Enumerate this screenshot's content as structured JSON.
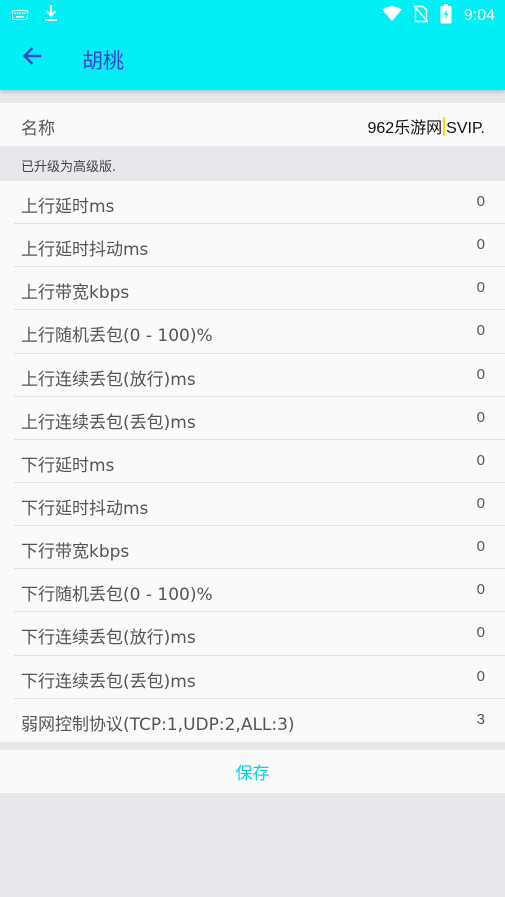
{
  "status_bar": {
    "time": "9:04",
    "icons": [
      "keyboard-icon",
      "download-icon",
      "wifi-icon",
      "no-sim-icon",
      "battery-icon"
    ]
  },
  "app_bar": {
    "title": "胡桃",
    "back_icon": "arrow-left-icon",
    "background": "#00f0f6",
    "title_color": "#3b44d6"
  },
  "name_field": {
    "label": "名称",
    "value_before_cursor": "962乐游网",
    "value_after_cursor": "SVIP."
  },
  "notice": "已升级为高级版.",
  "settings": [
    {
      "label": "上行延时ms",
      "value": "0"
    },
    {
      "label": "上行延时抖动ms",
      "value": "0"
    },
    {
      "label": "上行带宽kbps",
      "value": "0"
    },
    {
      "label": "上行随机丢包(0 - 100)%",
      "value": "0"
    },
    {
      "label": "上行连续丢包(放行)ms",
      "value": "0"
    },
    {
      "label": "上行连续丢包(丢包)ms",
      "value": "0"
    },
    {
      "label": "下行延时ms",
      "value": "0"
    },
    {
      "label": "下行延时抖动ms",
      "value": "0"
    },
    {
      "label": "下行带宽kbps",
      "value": "0"
    },
    {
      "label": "下行随机丢包(0 - 100)%",
      "value": "0"
    },
    {
      "label": "下行连续丢包(放行)ms",
      "value": "0"
    },
    {
      "label": "下行连续丢包(丢包)ms",
      "value": "0"
    },
    {
      "label": "弱网控制协议(TCP:1,UDP:2,ALL:3)",
      "value": "3"
    }
  ],
  "save_label": "保存",
  "accent_color": "#00d8e4"
}
